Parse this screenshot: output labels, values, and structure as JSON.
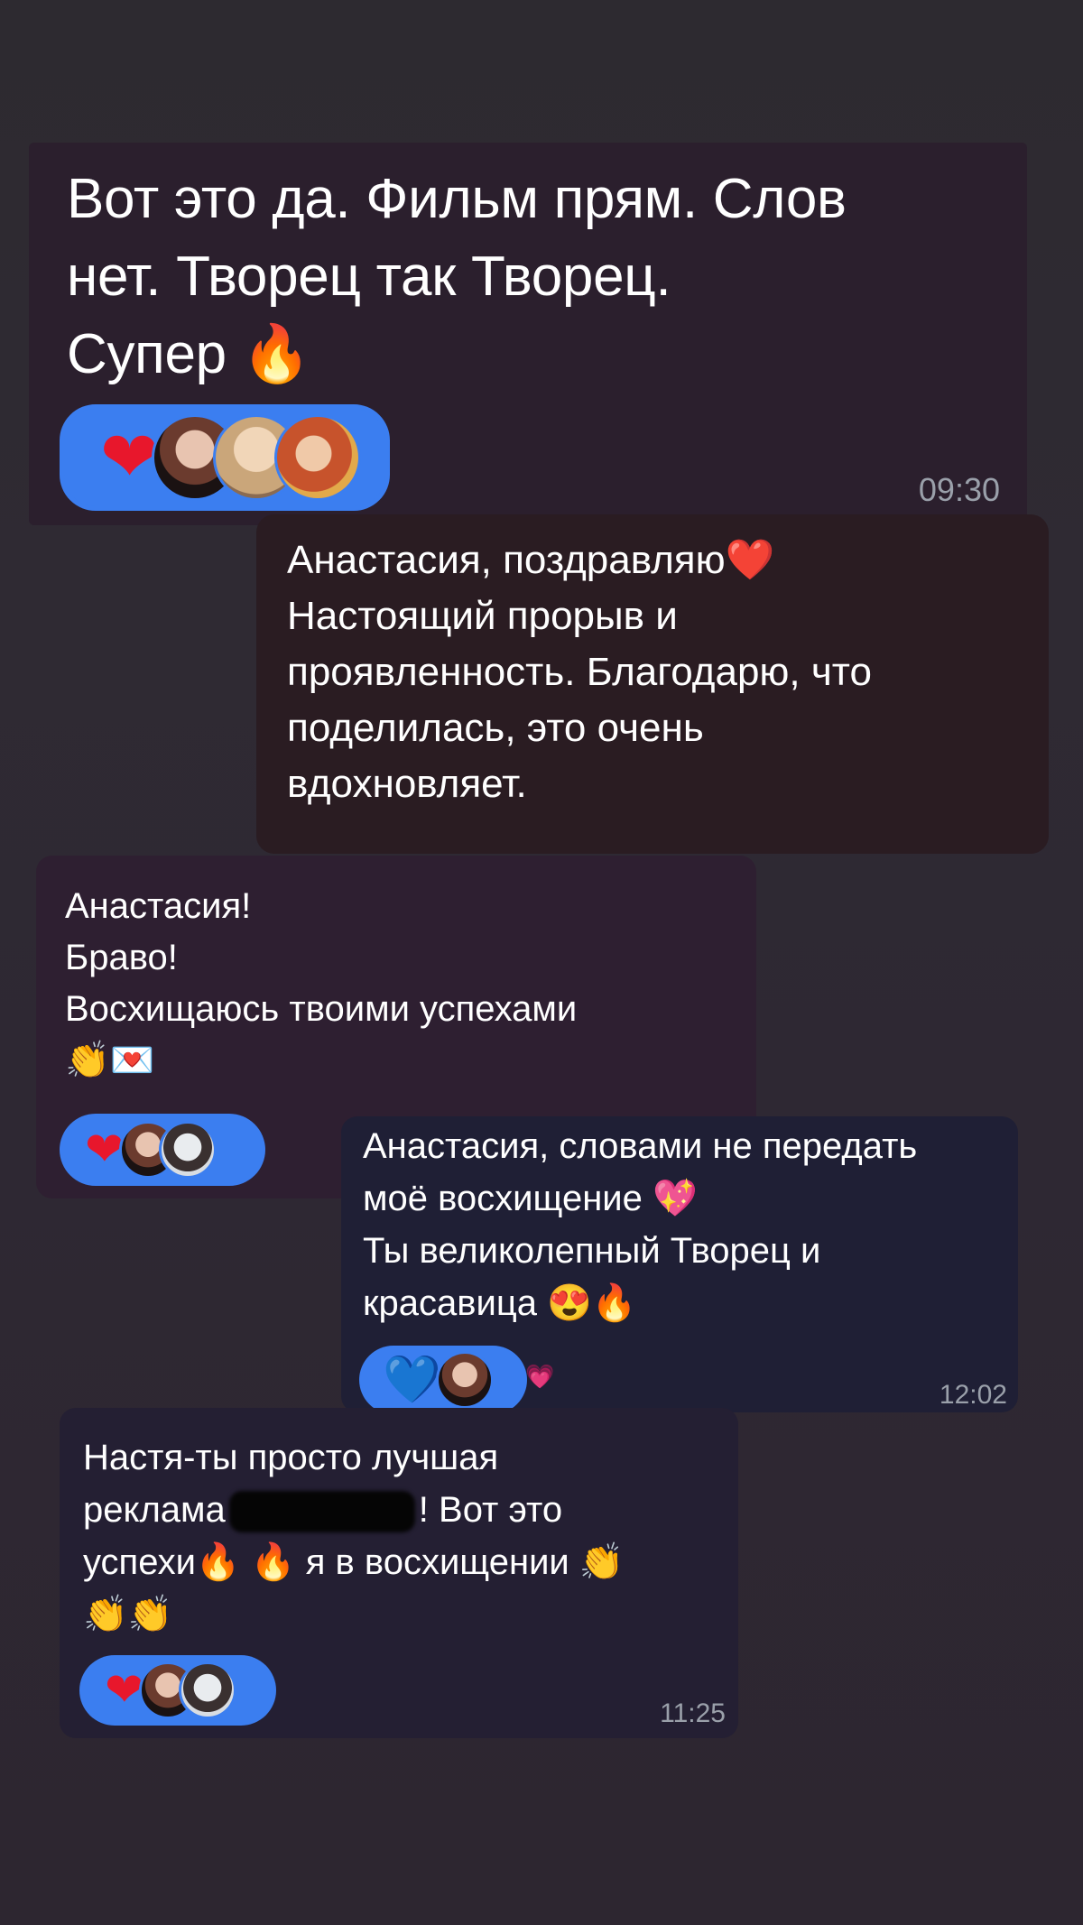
{
  "messages": [
    {
      "text": "Вот это да. Фильм прям. Слов\nнет. Творец так Творец.\nСупер 🔥",
      "time": "09:30",
      "reaction_heart": "❤"
    },
    {
      "text": "Анастасия, поздравляю❤️\nНастоящий прорыв и\nпроявленность. Благодарю, что\nподелилась, это очень\nвдохновляет."
    },
    {
      "text": "Анастасия!\nБраво!\nВосхищаюсь твоими успехами\n👏💌",
      "reaction_heart": "❤"
    },
    {
      "text": "Анастасия, словами не передать\nмоё восхищение 💖\nТы великолепный Творец и\nкрасавица 😍🔥",
      "time": "12:02",
      "reaction_heart": "💙",
      "extra": "💗"
    },
    {
      "text_line1": "Настя-ты просто лучшая",
      "text_line2_before": "реклама",
      "text_line2_after": "! Вот это",
      "text_line3": "успехи🔥 🔥 я в восхищении 👏",
      "text_line4": "👏👏",
      "time": "11:25",
      "reaction_heart": "❤"
    }
  ],
  "colors": {
    "reaction_bg": "#3b7ef0",
    "heart": "#e8172c",
    "timestamp": "#9aa0aa"
  }
}
